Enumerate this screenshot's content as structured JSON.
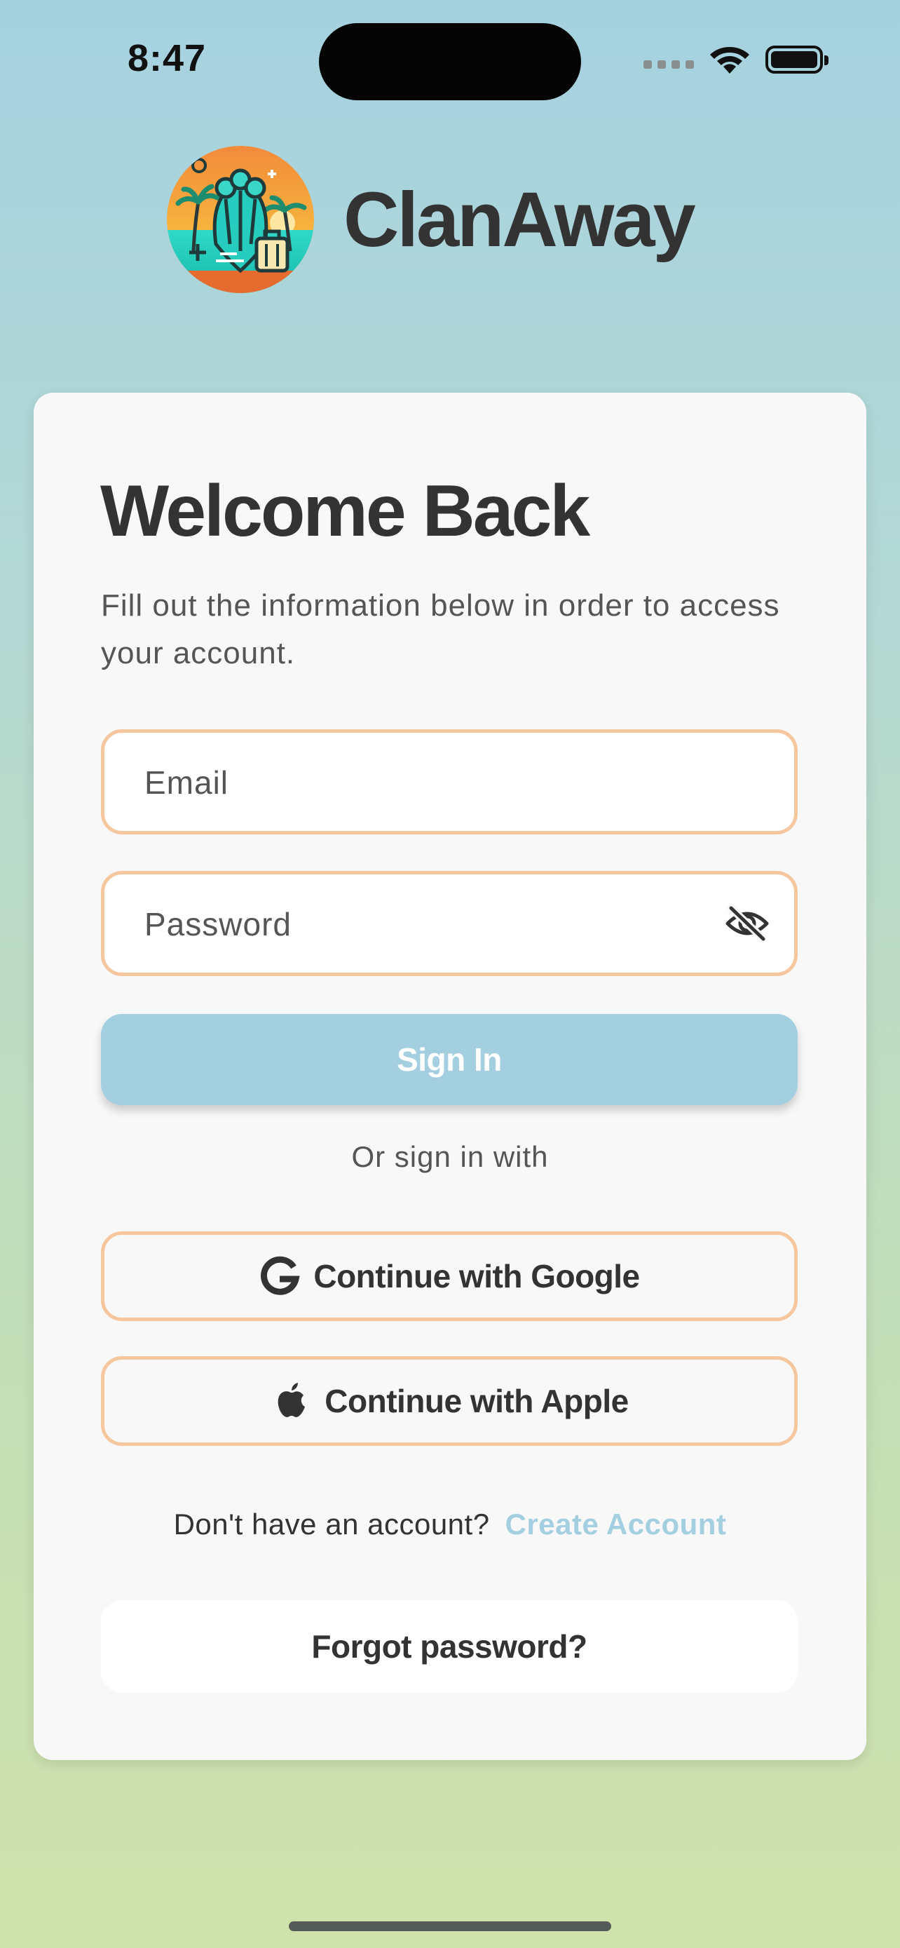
{
  "status_bar": {
    "time": "8:47"
  },
  "brand": {
    "name": "ClanAway",
    "logo_icon": "clanaway-logo"
  },
  "login": {
    "title": "Welcome Back",
    "subtitle": "Fill out the information below in order to access your account.",
    "email": {
      "placeholder": "Email",
      "value": ""
    },
    "password": {
      "placeholder": "Password",
      "value": "",
      "toggle_icon": "eye-slash-icon"
    },
    "sign_in_label": "Sign In",
    "divider_text": "Or sign in with",
    "google_label": "Continue with Google",
    "apple_label": "Continue with Apple",
    "signup_prompt": "Don't have an account?",
    "signup_link": "Create Account",
    "forgot_label": "Forgot password?"
  },
  "colors": {
    "accent": "#a3cfe0",
    "field_border": "#f6c79f",
    "text_primary": "#333333",
    "text_secondary": "#555555",
    "card_background": "#f8f8f8"
  }
}
